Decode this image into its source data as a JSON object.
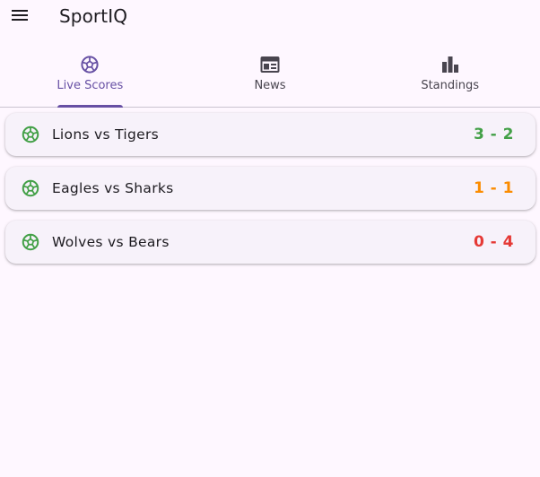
{
  "app": {
    "title": "SportIQ"
  },
  "tabs": [
    {
      "label": "Live Scores",
      "icon": "soccer-ball-icon",
      "active": true
    },
    {
      "label": "News",
      "icon": "newspaper-icon",
      "active": false
    },
    {
      "label": "Standings",
      "icon": "bar-chart-icon",
      "active": false
    }
  ],
  "matches": [
    {
      "teams": "Lions vs Tigers",
      "score": "3 - 2",
      "score_color": "#43a047",
      "icon": "soccer-ball-icon"
    },
    {
      "teams": "Eagles vs Sharks",
      "score": "1 - 1",
      "score_color": "#fb8c00",
      "icon": "soccer-ball-icon"
    },
    {
      "teams": "Wolves vs Bears",
      "score": "0 - 4",
      "score_color": "#e53935",
      "icon": "soccer-ball-icon"
    }
  ],
  "colors": {
    "accent": "#6750a4",
    "background": "#fef7ff",
    "card": "#f7f2fa",
    "match_icon": "#43a047"
  }
}
